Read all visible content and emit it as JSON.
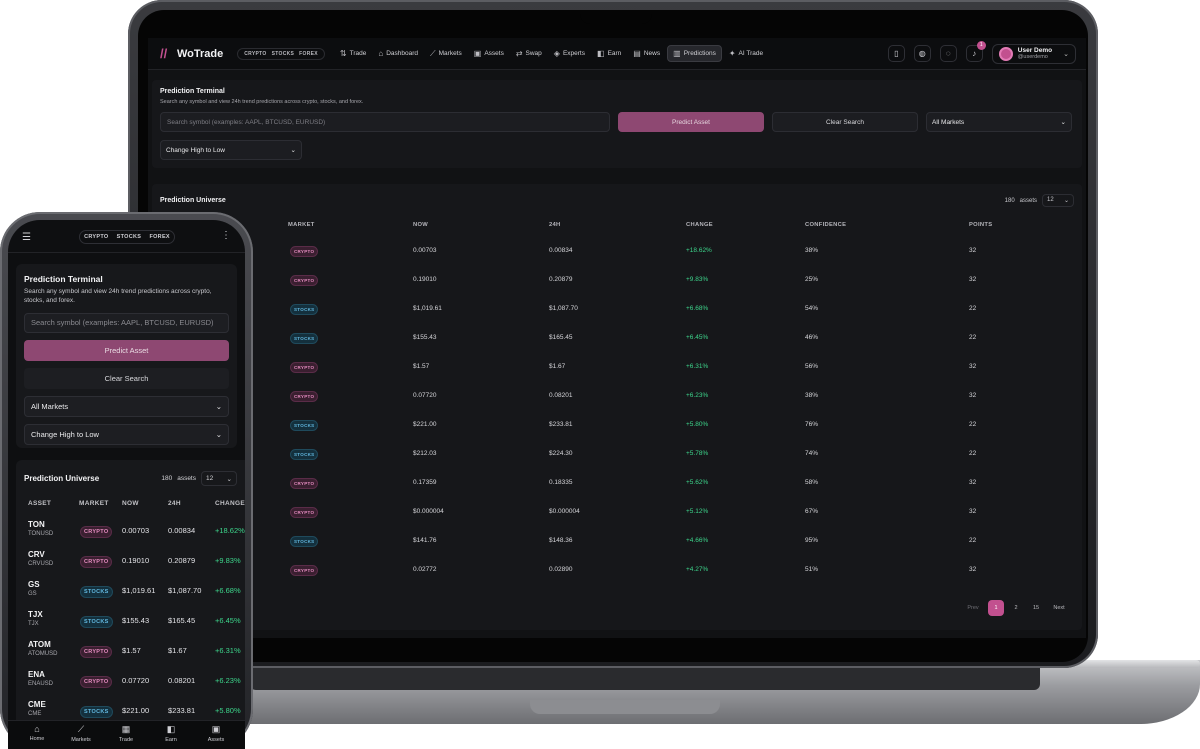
{
  "app": {
    "logo": "WoTrade"
  },
  "market_pill": [
    "CRYPTO",
    "STOCKS",
    "FOREX"
  ],
  "nav": [
    {
      "label": "Trade",
      "icon": "trade-icon"
    },
    {
      "label": "Dashboard",
      "icon": "chart-icon"
    },
    {
      "label": "Markets",
      "icon": "trend-icon"
    },
    {
      "label": "Assets",
      "icon": "wallet-icon"
    },
    {
      "label": "Swap",
      "icon": "swap-icon"
    },
    {
      "label": "Experts",
      "icon": "badge-icon"
    },
    {
      "label": "Earn",
      "icon": "earn-icon"
    },
    {
      "label": "News",
      "icon": "news-icon"
    },
    {
      "label": "Predictions",
      "icon": "bars-icon",
      "active": true
    },
    {
      "label": "AI Trade",
      "icon": "ai-icon"
    }
  ],
  "header": {
    "notifications": "1",
    "user_name": "User Demo",
    "user_handle": "@userdemo"
  },
  "terminal": {
    "title": "Prediction Terminal",
    "subtitle": "Search any symbol and view 24h trend predictions across crypto, stocks, and forex.",
    "search_placeholder": "Search symbol (examples: AAPL, BTCUSD, EURUSD)",
    "predict_label": "Predict Asset",
    "clear_label": "Clear Search",
    "market_filter": "All Markets",
    "sort": "Change High to Low"
  },
  "universe": {
    "title": "Prediction Universe",
    "count": "180",
    "count_label": "assets",
    "page_size": "12",
    "columns": [
      "ASSET",
      "MARKET",
      "NOW",
      "24H",
      "CHANGE",
      "CONFIDENCE",
      "POINTS"
    ],
    "rows": [
      {
        "symbol": "TON",
        "pair": "TONUSD",
        "market": "CRYPTO",
        "now": "0.00703",
        "h24": "0.00834",
        "change": "+18.62%",
        "confidence": "38%",
        "points": "32"
      },
      {
        "symbol": "CRV",
        "pair": "CRVUSD",
        "market": "CRYPTO",
        "now": "0.19010",
        "h24": "0.20879",
        "change": "+9.83%",
        "confidence": "25%",
        "points": "32"
      },
      {
        "symbol": "GS",
        "pair": "GS",
        "market": "STOCKS",
        "now": "$1,019.61",
        "h24": "$1,087.70",
        "change": "+6.68%",
        "confidence": "54%",
        "points": "22"
      },
      {
        "symbol": "TJX",
        "pair": "TJX",
        "market": "STOCKS",
        "now": "$155.43",
        "h24": "$165.45",
        "change": "+6.45%",
        "confidence": "46%",
        "points": "22"
      },
      {
        "symbol": "ATOM",
        "pair": "ATOMUSD",
        "market": "CRYPTO",
        "now": "$1.57",
        "h24": "$1.67",
        "change": "+6.31%",
        "confidence": "56%",
        "points": "32"
      },
      {
        "symbol": "ENA",
        "pair": "ENAUSD",
        "market": "CRYPTO",
        "now": "0.07720",
        "h24": "0.08201",
        "change": "+6.23%",
        "confidence": "38%",
        "points": "32"
      },
      {
        "symbol": "CME",
        "pair": "CME",
        "market": "STOCKS",
        "now": "$221.00",
        "h24": "$233.81",
        "change": "+5.80%",
        "confidence": "76%",
        "points": "22"
      },
      {
        "market": "STOCKS",
        "now": "$212.03",
        "h24": "$224.30",
        "change": "+5.78%",
        "confidence": "74%",
        "points": "22"
      },
      {
        "market": "CRYPTO",
        "now": "0.17359",
        "h24": "0.18335",
        "change": "+5.62%",
        "confidence": "58%",
        "points": "32"
      },
      {
        "market": "CRYPTO",
        "now": "$0.000004",
        "h24": "$0.000004",
        "change": "+5.12%",
        "confidence": "67%",
        "points": "32"
      },
      {
        "market": "STOCKS",
        "now": "$141.76",
        "h24": "$148.36",
        "change": "+4.66%",
        "confidence": "95%",
        "points": "22"
      },
      {
        "market": "CRYPTO",
        "now": "0.02772",
        "h24": "0.02890",
        "change": "+4.27%",
        "confidence": "51%",
        "points": "32"
      }
    ]
  },
  "pager": {
    "prev": "Prev",
    "pages": [
      "1",
      "2",
      "15"
    ],
    "next": "Next"
  },
  "phone": {
    "tabs": [
      {
        "label": "Home",
        "icon": "home-icon"
      },
      {
        "label": "Markets",
        "icon": "chart-icon"
      },
      {
        "label": "Trade",
        "icon": "trade-icon"
      },
      {
        "label": "Earn",
        "icon": "earn-icon"
      },
      {
        "label": "Assets",
        "icon": "wallet-icon"
      }
    ]
  },
  "colors": {
    "accent": "#c2508f",
    "button": "#8e4872",
    "positive": "#3dd68c",
    "crypto_chip": "#e58cc0",
    "stocks_chip": "#62b8e0"
  }
}
